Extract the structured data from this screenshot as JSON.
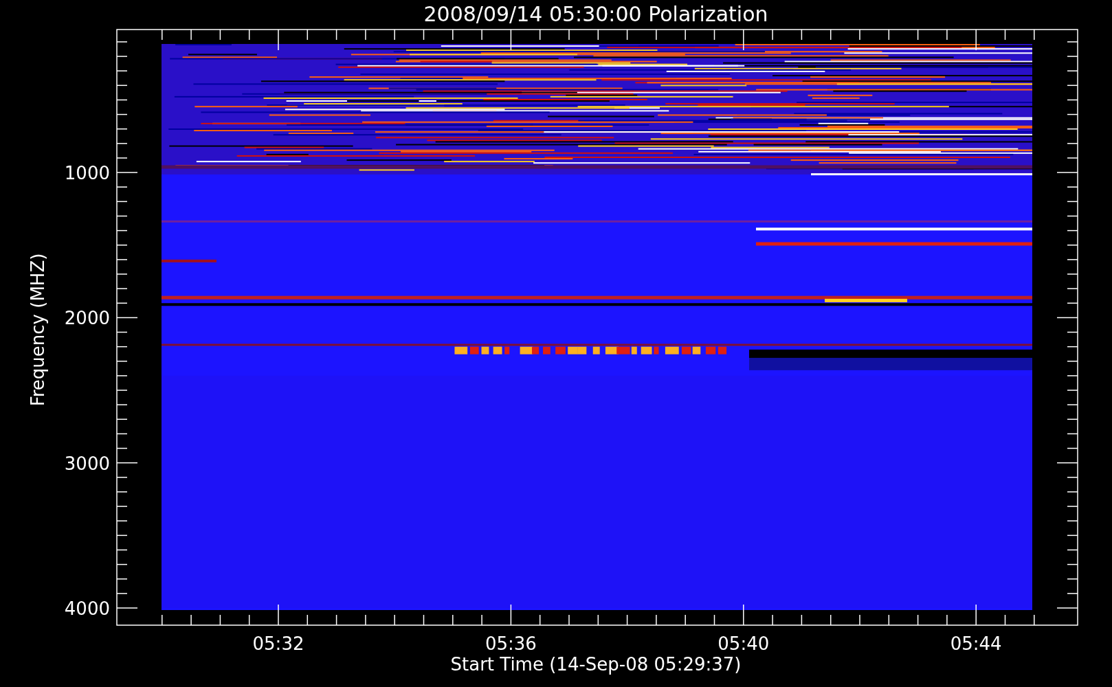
{
  "title": "2008/09/14 05:30:00 Polarization",
  "y_axis": {
    "label": "Frequency (MHZ)",
    "tick_labels": [
      "1000",
      "2000",
      "3000",
      "4000"
    ]
  },
  "x_axis": {
    "label": "Start Time (14-Sep-08 05:29:37)",
    "tick_labels": [
      "05:32",
      "05:36",
      "05:40",
      "05:44"
    ]
  }
}
